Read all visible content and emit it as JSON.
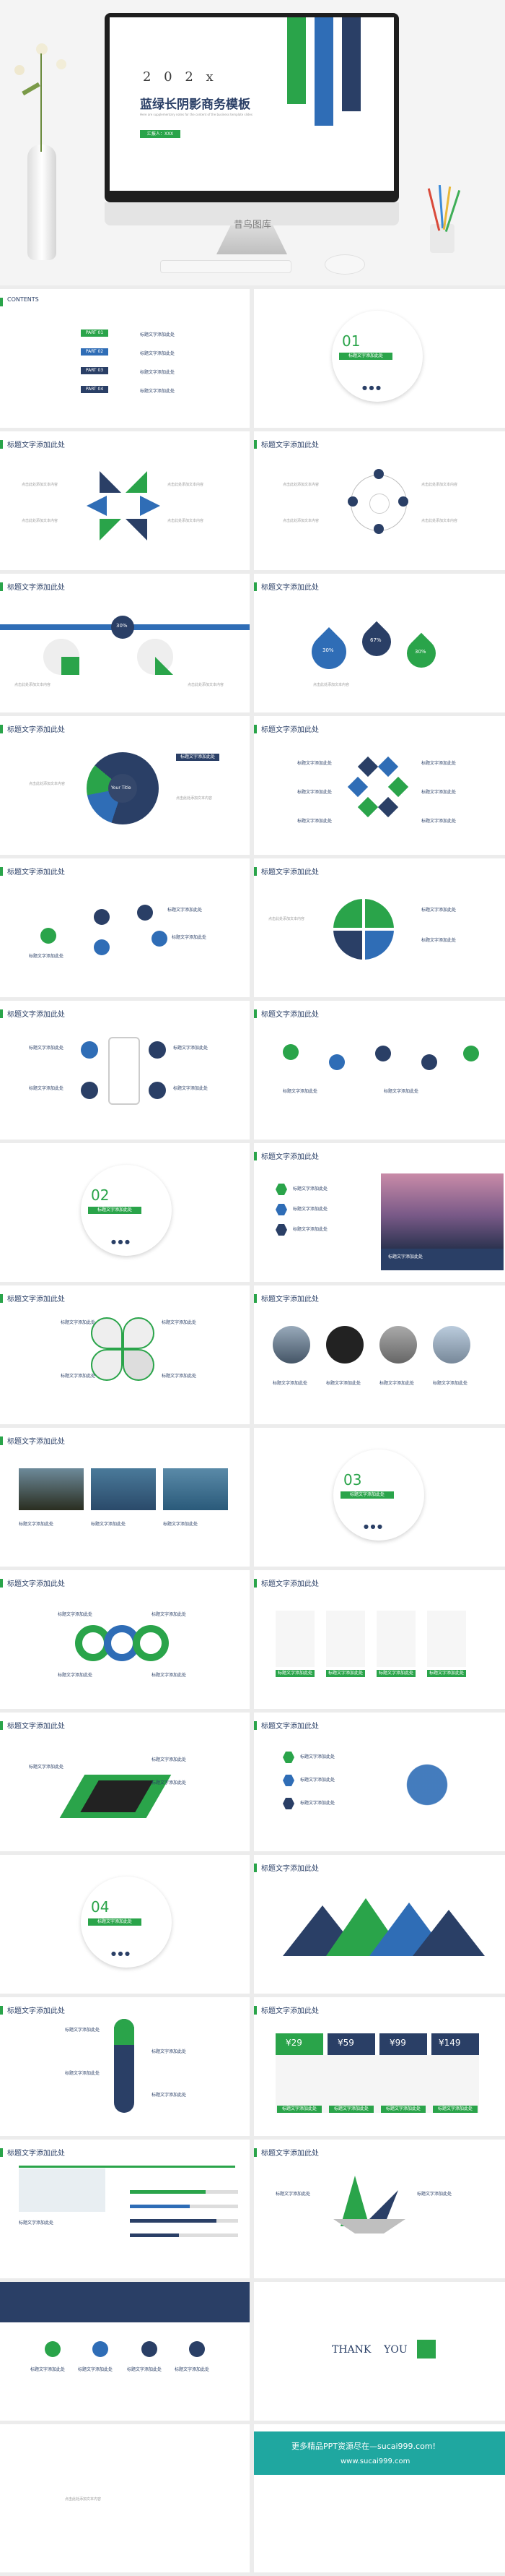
{
  "cover": {
    "year": "2 0 2 x",
    "title": "蓝绿长阴影商务模板",
    "subtitle": "Here are supplementary notes for the content of the business template slides",
    "tag": "汇报人：XXX",
    "watermark": "昔鸟图库"
  },
  "contents": {
    "heading": "CONTENTS",
    "items": [
      {
        "part": "PART 01",
        "label": "标题文字添加此处"
      },
      {
        "part": "PART 02",
        "label": "标题文字添加此处"
      },
      {
        "part": "PART 03",
        "label": "标题文字添加此处"
      },
      {
        "part": "PART 04",
        "label": "标题文字添加此处"
      }
    ]
  },
  "section": {
    "s01": "01",
    "s02": "02",
    "s03": "03",
    "s04": "04",
    "label": "标题文字添加此处"
  },
  "slide_title": "标题文字添加此处",
  "label": "标题文字添加此处",
  "body": "点击此处添加文本内容",
  "pct": [
    "30%",
    "30%",
    "67%",
    "30%",
    "40%"
  ],
  "pie_center": "Your Title",
  "prices": [
    "¥29",
    "¥59",
    "¥99",
    "¥149"
  ],
  "thanks": "THANK    YOU",
  "footer": {
    "line1": "更多精品PPT资源尽在—sucai999.com!",
    "line2": "www.sucai999.com"
  }
}
